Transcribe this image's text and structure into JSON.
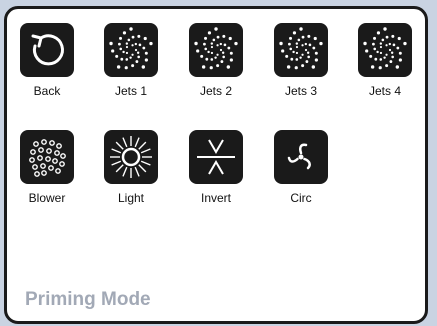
{
  "buttons": [
    {
      "label": "Back",
      "icon": "back-arrow-icon"
    },
    {
      "label": "Jets 1",
      "icon": "jets-swirl-icon"
    },
    {
      "label": "Jets 2",
      "icon": "jets-swirl-icon"
    },
    {
      "label": "Jets 3",
      "icon": "jets-swirl-icon"
    },
    {
      "label": "Jets 4",
      "icon": "jets-swirl-icon"
    },
    {
      "label": "Blower",
      "icon": "blower-bubbles-icon"
    },
    {
      "label": "Light",
      "icon": "light-sun-icon"
    },
    {
      "label": "Invert",
      "icon": "invert-icon"
    },
    {
      "label": "Circ",
      "icon": "circ-pump-icon"
    }
  ],
  "status": {
    "mode_text": "Priming Mode"
  },
  "colors": {
    "tile": "#1a1a1a",
    "background": "#c9d3e2",
    "mode_text": "#a2a9b6"
  }
}
